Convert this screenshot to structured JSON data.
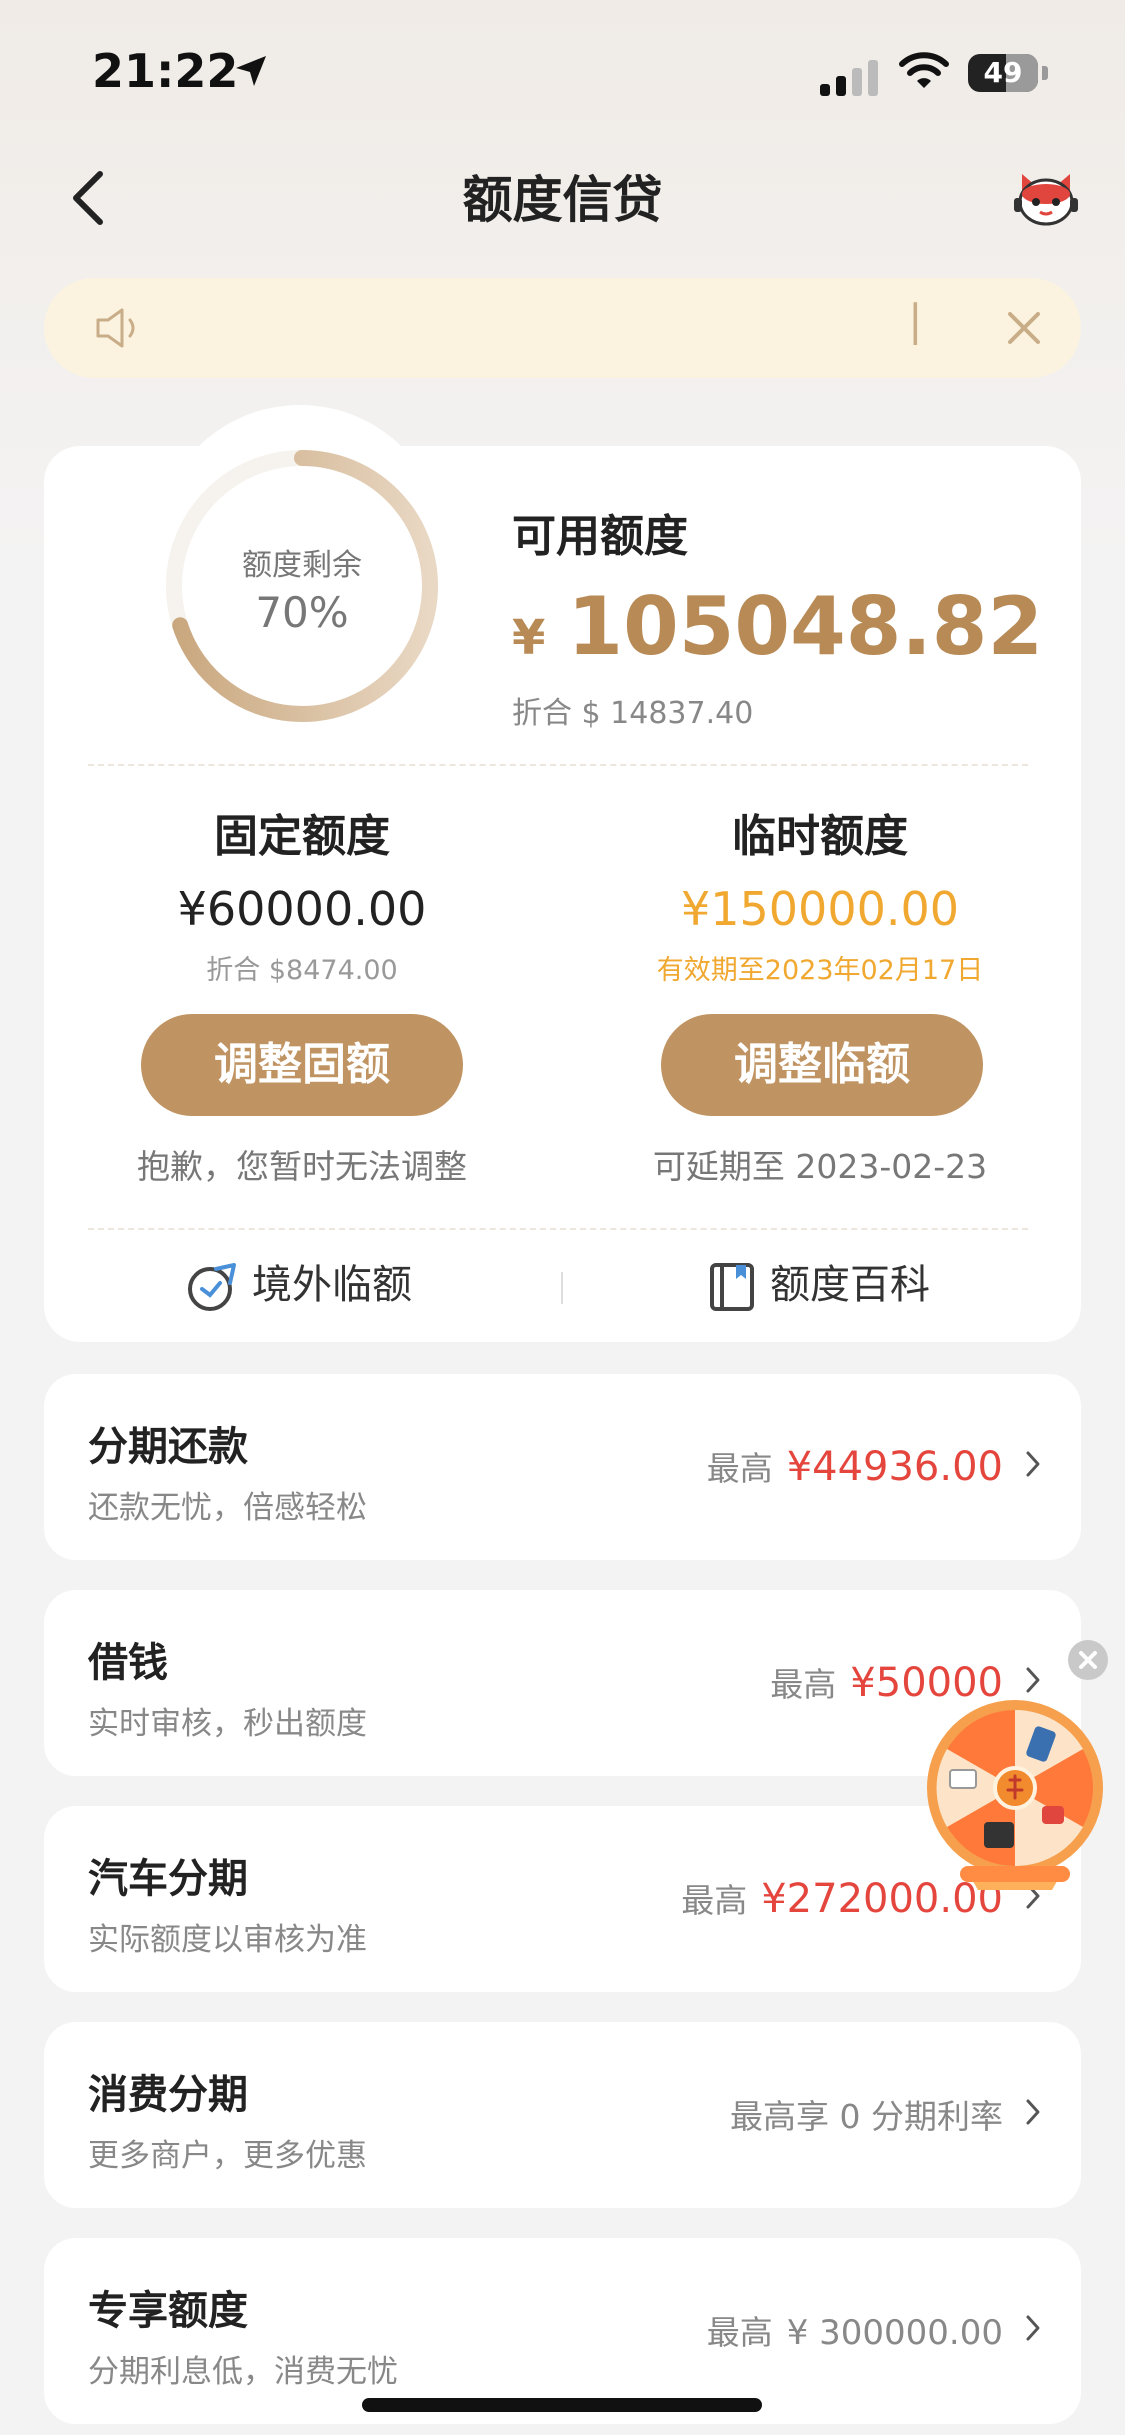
{
  "status_bar": {
    "time": "21:22",
    "battery": "49"
  },
  "nav": {
    "title": "额度信贷"
  },
  "summary": {
    "ring_label": "额度剩余",
    "ring_percent": "70%",
    "ring_fraction": 0.7,
    "available_label": "可用额度",
    "available_currency": "¥",
    "available_amount": "105048.82",
    "available_usd": "折合 $ 14837.40"
  },
  "fixed": {
    "title": "固定额度",
    "amount": "¥60000.00",
    "sub": "折合 $8474.00",
    "button": "调整固额",
    "note": "抱歉，您暂时无法调整"
  },
  "temporary": {
    "title": "临时额度",
    "amount": "¥150000.00",
    "sub": "有效期至2023年02月17日",
    "button": "调整临额",
    "note": "可延期至 2023-02-23"
  },
  "quick_links": [
    {
      "label": "境外临额",
      "icon": "globe-plane-icon"
    },
    {
      "label": "额度百科",
      "icon": "book-icon"
    }
  ],
  "products": [
    {
      "title": "分期还款",
      "subtitle": "还款无忧，倍感轻松",
      "prefix": "最高",
      "value": "¥44936.00"
    },
    {
      "title": "借钱",
      "subtitle": "实时审核，秒出额度",
      "prefix": "最高",
      "value": "¥50000"
    },
    {
      "title": "汽车分期",
      "subtitle": "实际额度以审核为准",
      "prefix": "最高",
      "value": "¥272000.00"
    },
    {
      "title": "消费分期",
      "subtitle": "更多商户，更多优惠",
      "prefix": "最高享 0 分期利率",
      "value": ""
    },
    {
      "title": "专享额度",
      "subtitle": "分期利息低，消费无忧",
      "prefix": "最高",
      "value": "¥ 300000.00"
    }
  ],
  "colors": {
    "accent_gold": "#b88a55",
    "button_gold": "#c09462",
    "temp_orange": "#f0a830",
    "price_red": "#e4463e"
  }
}
